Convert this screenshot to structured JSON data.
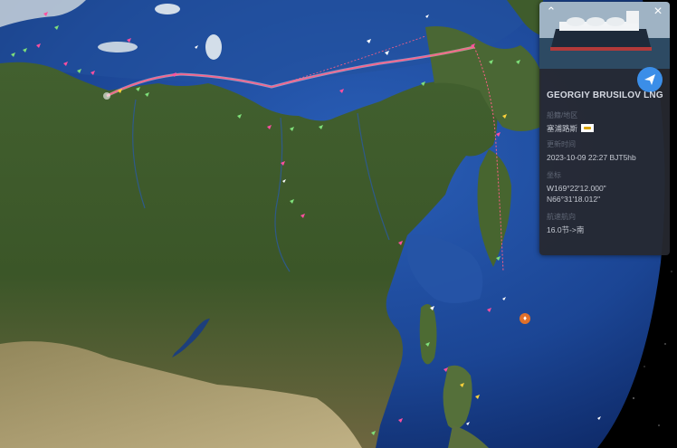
{
  "panel": {
    "vessel_name": "GEORGIY BRUSILOV LNG",
    "flag_label": "船籍/地区",
    "flag_value": "塞浦路斯",
    "flag_icon": "cyprus-flag-icon",
    "updated_label": "更新时间",
    "updated_value": "2023-10-09 22:27 BJT5hb",
    "coords_label": "坐标",
    "longitude": "W169°22'12.000\"",
    "latitude": "N66°31'18.012\"",
    "course_label": "航速航向",
    "course_value": "16.0节->南",
    "collapse_icon": "chevron-up-icon",
    "close_icon": "close-icon",
    "share_icon": "send-icon"
  },
  "colors": {
    "ocean_deep": "#0e2a6e",
    "ocean": "#1f4fa8",
    "land_green": "#3d5a2a",
    "land_brown": "#8a7a55",
    "ice": "#e8ecef",
    "route": "#ff6a8a",
    "route_glow": "#ffd0dc",
    "panel_bg": "#26282f",
    "accent_blue": "#3b8ee8"
  },
  "map": {
    "view": "globe-satellite",
    "route_icon": "vessel-route-line",
    "marker_icon": "ship-marker-icon",
    "locate_icon": "fire-location-icon"
  }
}
